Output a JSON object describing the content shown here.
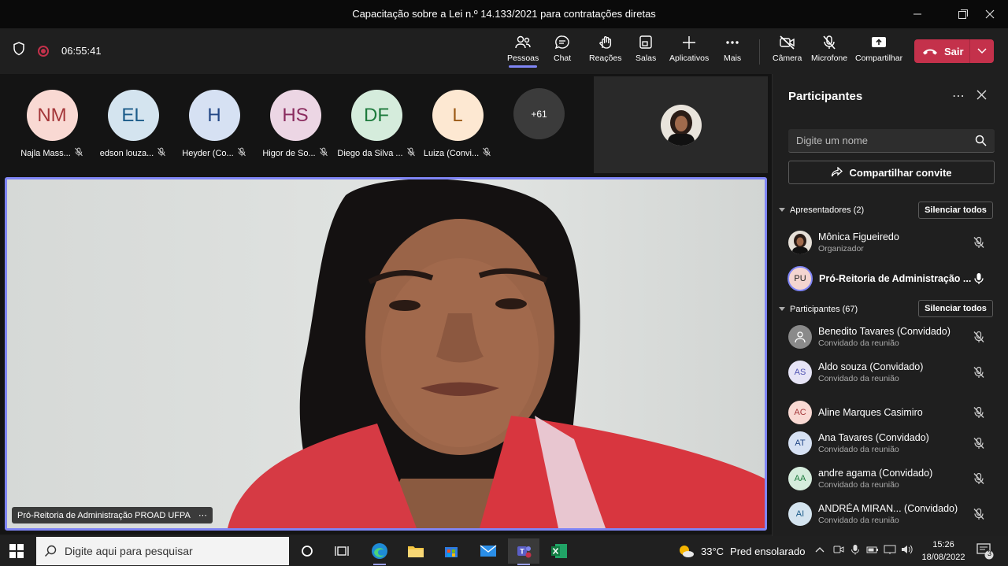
{
  "window": {
    "title": "Capacitação sobre a Lei n.º 14.133/2021 para contratações diretas"
  },
  "toolbar": {
    "timer": "06:55:41",
    "buttons": {
      "people": "Pessoas",
      "chat": "Chat",
      "reactions": "Reações",
      "rooms": "Salas",
      "apps": "Aplicativos",
      "more": "Mais",
      "camera": "Câmera",
      "mic": "Microfone",
      "share": "Compartilhar"
    },
    "leave_label": "Sair"
  },
  "gallery": {
    "tiles": [
      {
        "initials": "NM",
        "name": "Najla Mass...",
        "bg": "#f9d9d3",
        "fg": "#a4373a"
      },
      {
        "initials": "EL",
        "name": "edson louza...",
        "bg": "#d4e4ef",
        "fg": "#1c5c8a"
      },
      {
        "initials": "H",
        "name": "Heyder (Co...",
        "bg": "#d6e1f3",
        "fg": "#234786"
      },
      {
        "initials": "HS",
        "name": "Higor de So...",
        "bg": "#ecd6e4",
        "fg": "#8a2b5e"
      },
      {
        "initials": "DF",
        "name": "Diego da Silva ...",
        "bg": "#d5ecdc",
        "fg": "#1d7a3c"
      },
      {
        "initials": "L",
        "name": "Luiza (Convi...",
        "bg": "#fde8d2",
        "fg": "#9c5b17"
      }
    ],
    "more_count": "+61"
  },
  "main_video": {
    "label": "Pró-Reitoria de Administração PROAD UFPA"
  },
  "panel": {
    "title": "Participantes",
    "search_placeholder": "Digite um nome",
    "share_invite": "Compartilhar convite",
    "presenters_header": "Apresentadores (2)",
    "participants_header": "Participantes (67)",
    "mute_all": "Silenciar todos",
    "presenters": [
      {
        "name": "Mônica Figueiredo",
        "role": "Organizador",
        "avatar": "photo"
      },
      {
        "name": "Pró-Reitoria de Administração ...",
        "role": "",
        "initials": "PU"
      }
    ],
    "participants": [
      {
        "name": "Benedito Tavares (Convidado)",
        "role": "Convidado da reunião",
        "initials": "",
        "bg": "#8a8a8a"
      },
      {
        "name": "Aldo souza (Convidado)",
        "role": "Convidado da reunião",
        "initials": "AS",
        "bg": "#e6e4f6",
        "fg": "#4f52b2"
      },
      {
        "name": "Aline Marques Casimiro",
        "role": "",
        "initials": "AC",
        "bg": "#f9d9d3",
        "fg": "#a4373a"
      },
      {
        "name": "Ana Tavares (Convidado)",
        "role": "Convidado da reunião",
        "initials": "AT",
        "bg": "#d6e1f3",
        "fg": "#234786"
      },
      {
        "name": "andre agama (Convidado)",
        "role": "Convidado da reunião",
        "initials": "AA",
        "bg": "#d5ecdc",
        "fg": "#1d7a3c"
      },
      {
        "name": "ANDRÉA MIRAN... (Convidado)",
        "role": "Convidado da reunião",
        "initials": "AI",
        "bg": "#d4e4ef",
        "fg": "#1c5c8a"
      }
    ]
  },
  "taskbar": {
    "search_placeholder": "Digite aqui para pesquisar",
    "weather_temp": "33°C",
    "weather_desc": "Pred ensolarado",
    "time": "15:26",
    "date": "18/08/2022",
    "notifications": "3"
  },
  "colors": {
    "accent": "#7f85f5",
    "leave": "#c4314b"
  }
}
